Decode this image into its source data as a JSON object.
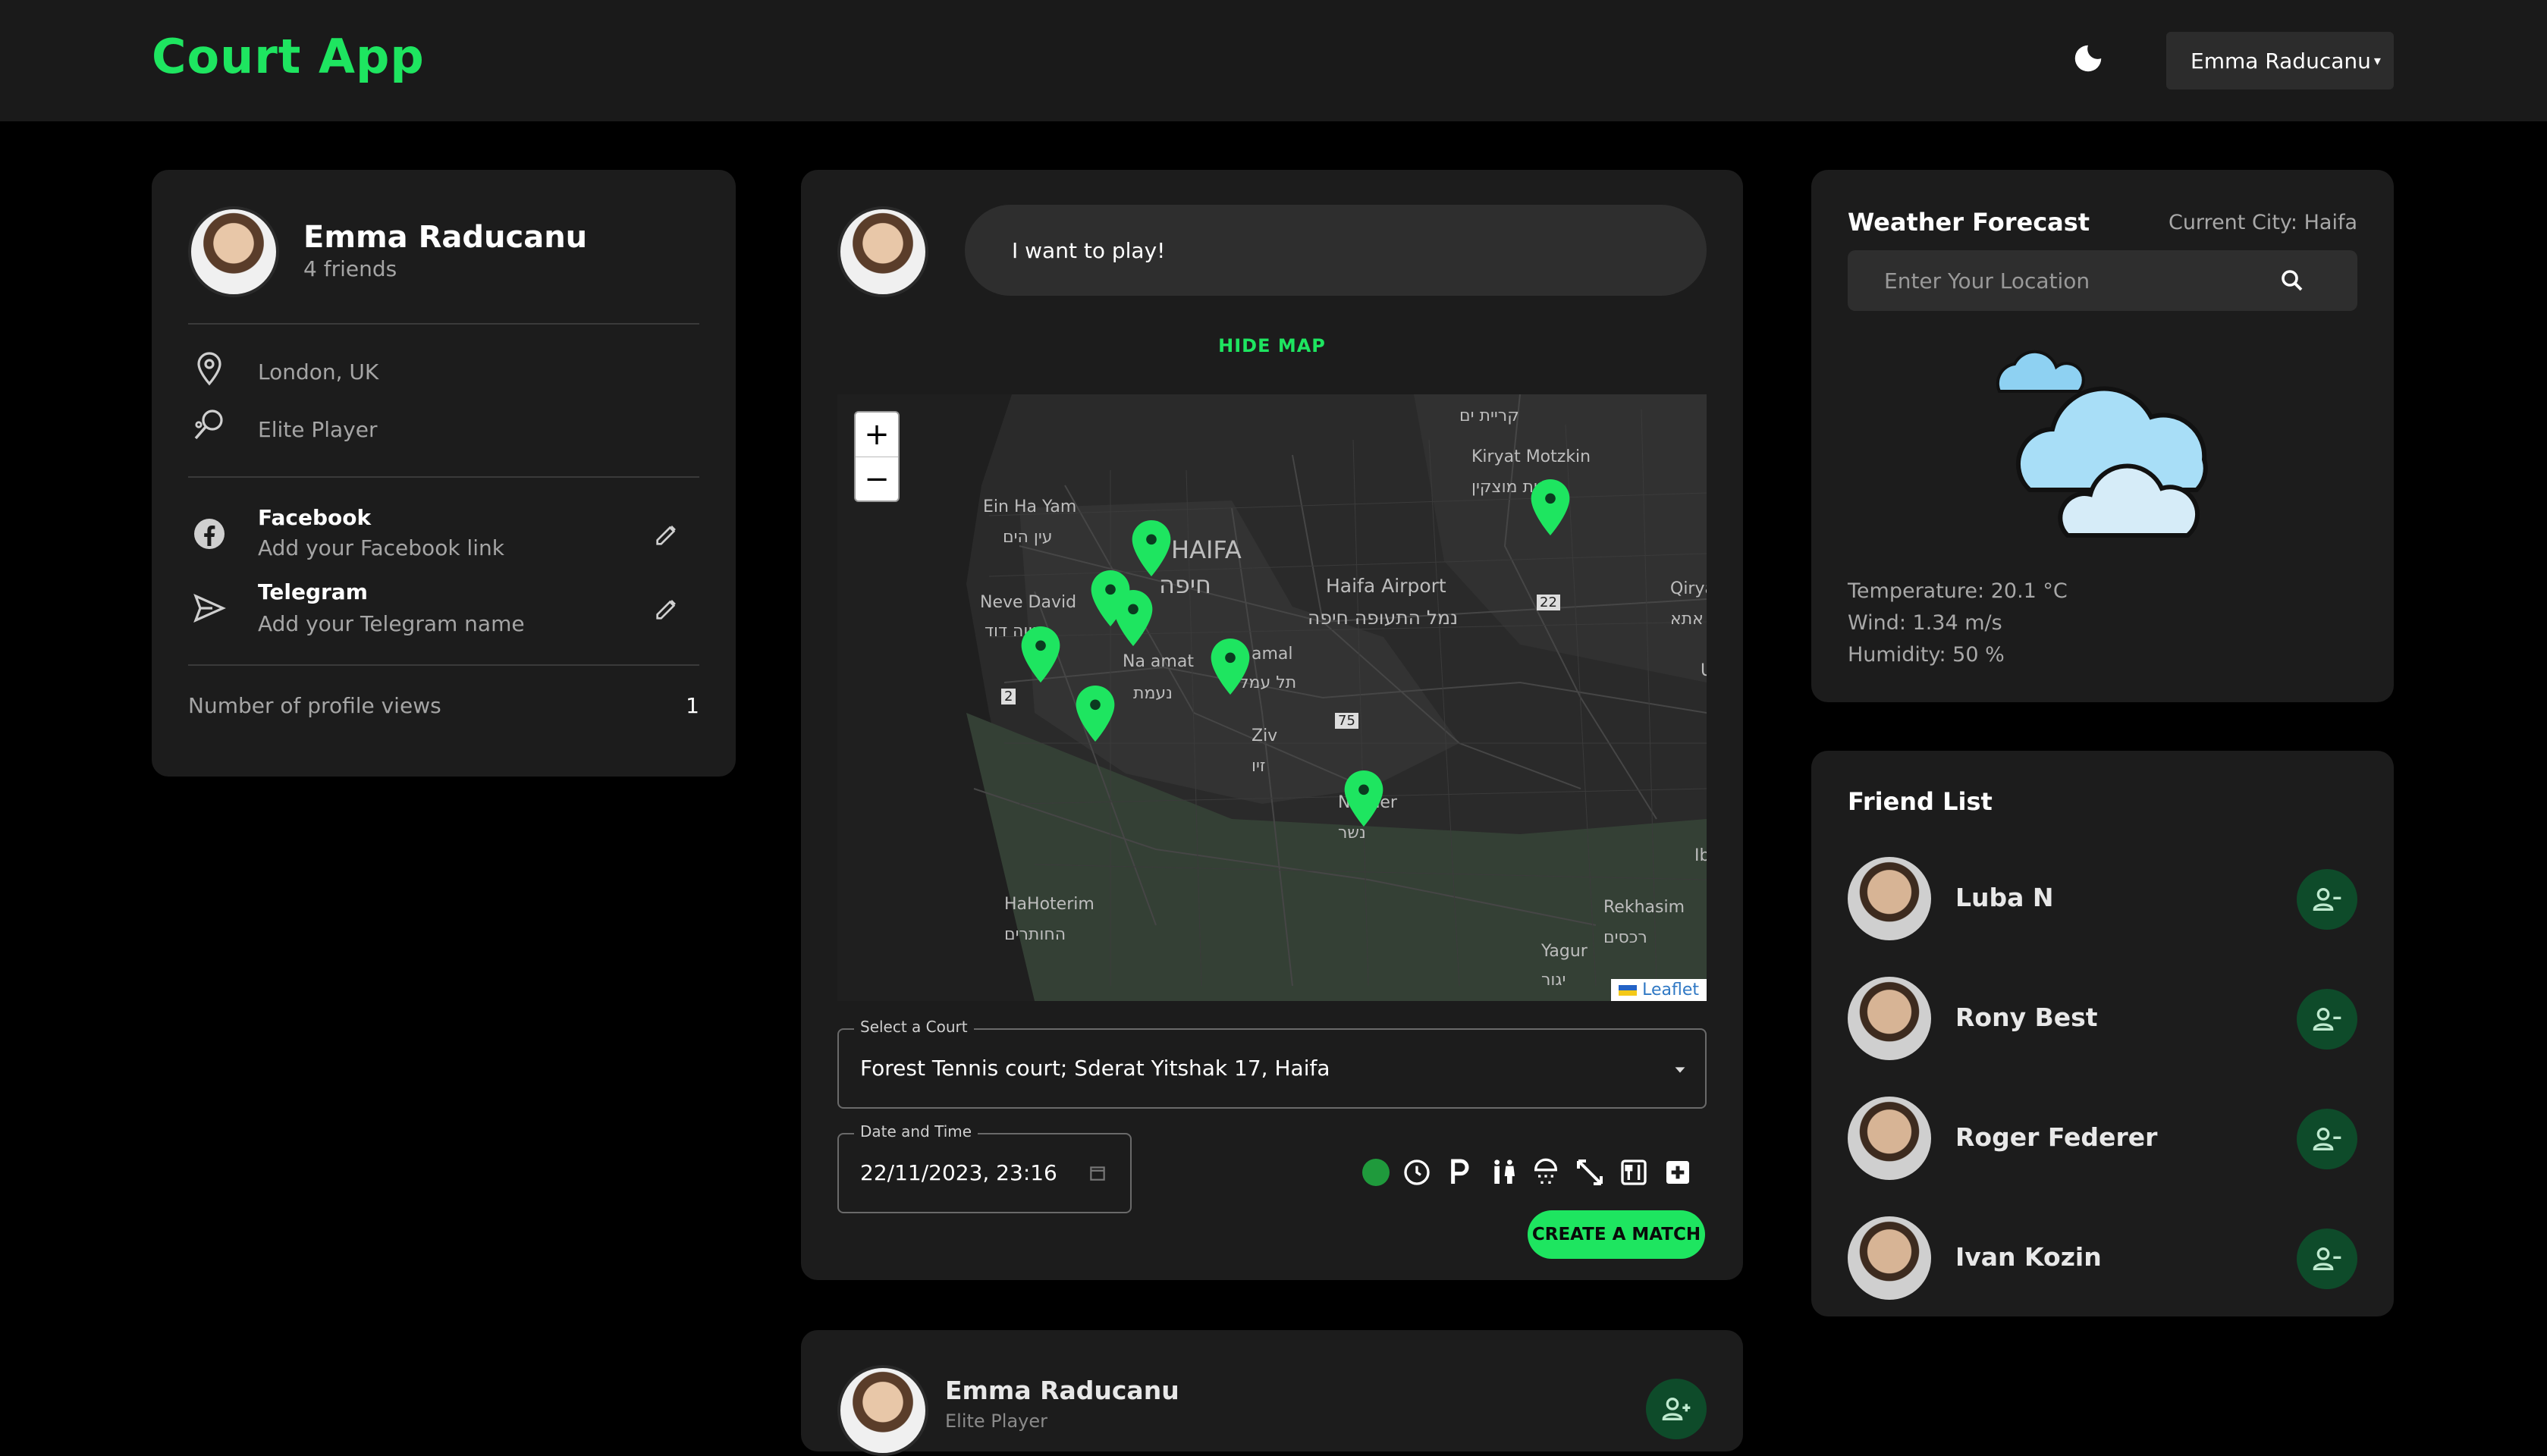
{
  "app": {
    "title": "Court App",
    "user_menu_label": "Emma Raducanu"
  },
  "profile": {
    "name": "Emma Raducanu",
    "friends": "4 friends",
    "location": "London, UK",
    "level": "Elite Player",
    "socials": [
      {
        "label": "Facebook",
        "value": "Add your Facebook link"
      },
      {
        "label": "Telegram",
        "value": "Add your Telegram name"
      }
    ],
    "views_label": "Number of profile views",
    "views_count": "1"
  },
  "composer": {
    "placeholder": "I want to play!",
    "toggle_map_label": "HIDE MAP",
    "court_label": "Select a Court",
    "court_value": "Forest Tennis court; Sderat Yitshak 17, Haifa",
    "datetime_label": "Date and Time",
    "datetime_value": "22/11/2023, 23:16",
    "create_label": "CREATE A MATCH"
  },
  "map": {
    "attribution": "Leaflet",
    "labels": [
      "קריית ים",
      "Kiryat Motzkin",
      "קריית מוצקין",
      "Ein Ha Yam",
      "עין הים",
      "HAIFA",
      "חיפה",
      "Neve David",
      "נווה דוד",
      "Haifa Airport",
      "נמל התעופה חיפה",
      "Na amat",
      "נעמת",
      "amal",
      "תל עמל",
      "Ziv",
      "זיו",
      "Nesher",
      "נשר",
      "HaHoterim",
      "החותרים",
      "Rekhasim",
      "רכסים",
      "Yagur",
      "יגור",
      "Qiryat",
      "אתא",
      "Ib",
      "U",
      "22",
      "75",
      "2"
    ]
  },
  "weather": {
    "title": "Weather Forecast",
    "city": "Current City: Haifa",
    "search_placeholder": "Enter Your Location",
    "temperature": "Temperature: 20.1 °C",
    "wind": "Wind: 1.34 m/s",
    "humidity": "Humidity: 50 %"
  },
  "friends": {
    "title": "Friend List",
    "items": [
      {
        "name": "Luba N"
      },
      {
        "name": "Rony Best"
      },
      {
        "name": "Roger Federer"
      },
      {
        "name": "Ivan Kozin"
      }
    ]
  },
  "post": {
    "name": "Emma Raducanu",
    "subtitle": "Elite Player"
  },
  "colors": {
    "accent": "#1ee560",
    "card": "#1c1c1c",
    "background": "#000000"
  }
}
